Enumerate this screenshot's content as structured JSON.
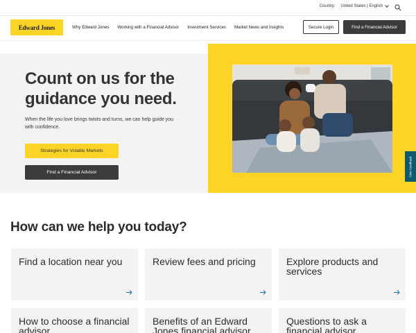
{
  "utility": {
    "country_label": "Country:",
    "country_value": "United States | English"
  },
  "nav": {
    "logo": "Edward Jones",
    "links": [
      "Why Edward Jones",
      "Working with a Financial Advisor",
      "Investment Services",
      "Market News and Insights"
    ],
    "login": "Secure Login",
    "find_advisor": "Find a Financial Advisor"
  },
  "hero": {
    "title": "Count on us for the guidance you need.",
    "subtitle": "When the life you love brings twists and turns, we can help guide you with confidence.",
    "primary_button": "Strategies for Volatile Markets",
    "secondary_button": "Find a Financial Advisor"
  },
  "feedback": "Give Feedback",
  "help": {
    "title": "How can we help you today?",
    "cards": [
      "Find a location near you",
      "Review fees and pricing",
      "Explore products and services",
      "How to choose a financial advisor",
      "Benefits of an Edward Jones financial advisor",
      "Questions to ask a financial advisor"
    ]
  },
  "colors": {
    "brand_yellow": "#fbd426",
    "dark_button": "#3b3b3b",
    "feedback_teal": "#0b5a6e",
    "arrow_blue": "#1a6fa8"
  }
}
